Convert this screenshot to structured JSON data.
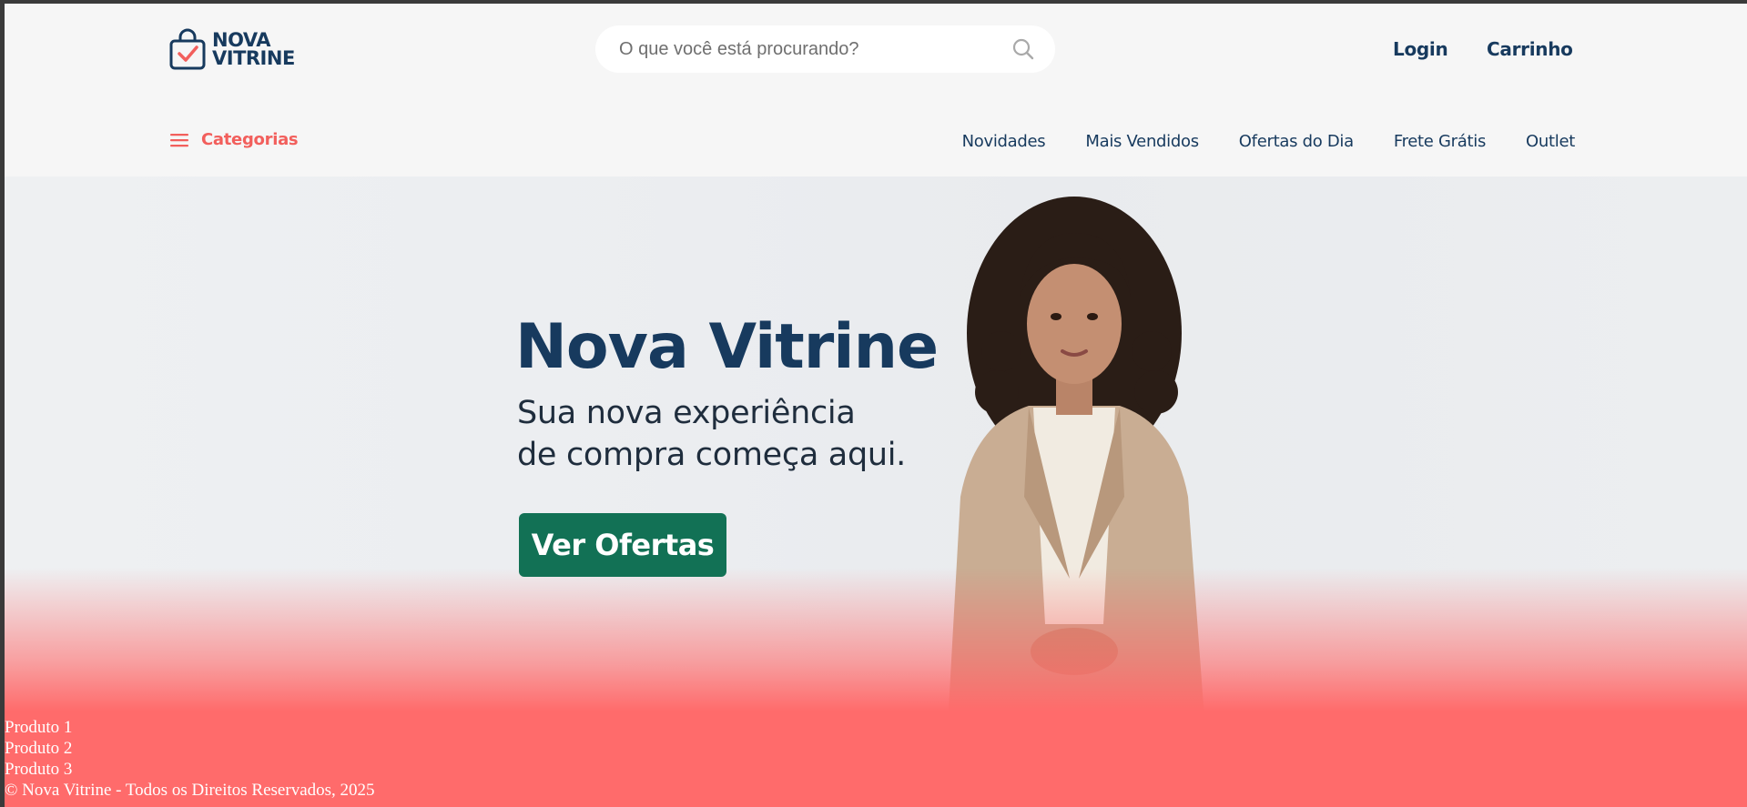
{
  "header": {
    "logo": {
      "line1": "NOVA",
      "line2": "VITRINE"
    },
    "search": {
      "placeholder": "O que você está procurando?"
    },
    "login_label": "Login",
    "cart_label": "Carrinho"
  },
  "nav": {
    "categories_label": "Categorias",
    "items": [
      {
        "label": "Novidades"
      },
      {
        "label": "Mais Vendidos"
      },
      {
        "label": "Ofertas do Dia"
      },
      {
        "label": "Frete Grátis"
      },
      {
        "label": "Outlet"
      }
    ]
  },
  "hero": {
    "title": "Nova Vitrine",
    "subtitle_line1": "Sua nova experiência",
    "subtitle_line2": "de compra começa aqui.",
    "cta_label": "Ver Ofertas"
  },
  "products": [
    {
      "label": "Produto 1"
    },
    {
      "label": "Produto 2"
    },
    {
      "label": "Produto 3"
    }
  ],
  "footer": {
    "copyright": "© Nova Vitrine - Todos os Direitos Reservados, 2025"
  },
  "colors": {
    "brand_navy": "#173a5e",
    "accent_coral": "#f25f5c",
    "cta_green": "#127155",
    "footer_red": "#ff6b6b"
  }
}
